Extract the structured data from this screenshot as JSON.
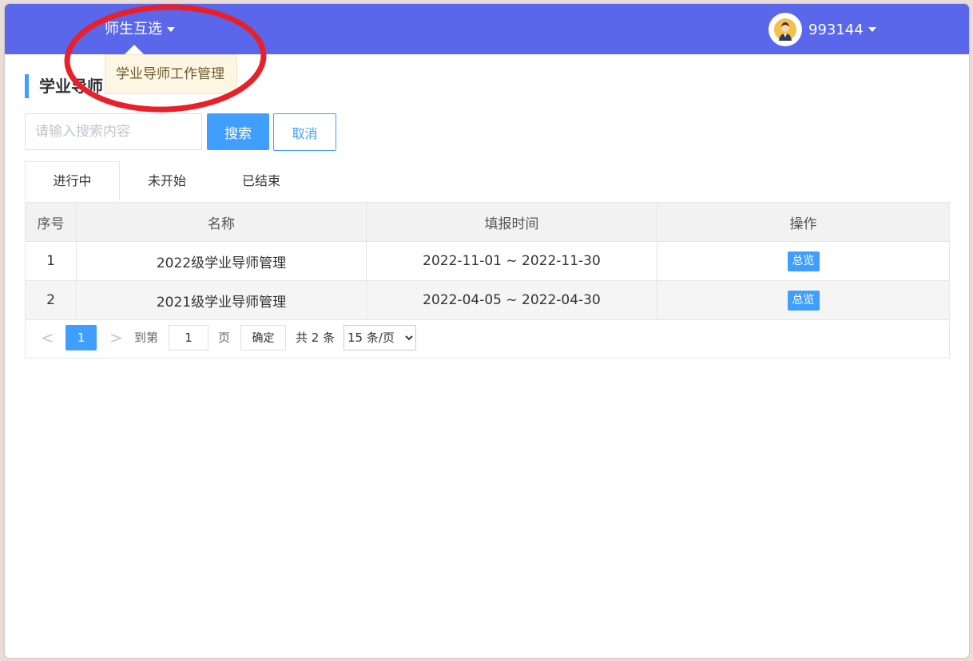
{
  "header": {
    "nav_menu_label": "师生互选",
    "dropdown_items": [
      "学业导师工作管理"
    ],
    "username": "993144"
  },
  "main": {
    "page_title": "学业导师",
    "search": {
      "placeholder": "请输入搜索内容",
      "value": ""
    },
    "search_button": "搜索",
    "cancel_button": "取消",
    "tabs": [
      {
        "label": "进行中",
        "active": true
      },
      {
        "label": "未开始",
        "active": false
      },
      {
        "label": "已结束",
        "active": false
      }
    ],
    "table": {
      "columns": [
        "序号",
        "名称",
        "填报时间",
        "操作"
      ],
      "rows": [
        {
          "index": "1",
          "name": "2022级学业导师管理",
          "period": "2022-11-01 ~ 2022-11-30",
          "action": "总览"
        },
        {
          "index": "2",
          "name": "2021级学业导师管理",
          "period": "2022-04-05 ~ 2022-04-30",
          "action": "总览"
        }
      ]
    },
    "pagination": {
      "prev": "<",
      "next": ">",
      "current_page": "1",
      "goto_prefix": "到第",
      "goto_value": "1",
      "goto_suffix": "页",
      "confirm": "确定",
      "total": "共 2 条",
      "page_size": "15 条/页"
    }
  },
  "colors": {
    "header_bg": "#5b67ea",
    "primary": "#409eff",
    "annotation": "#e8202a"
  },
  "icons": {
    "avatar": "user-avatar-icon",
    "caret": "caret-down-icon",
    "prev": "chevron-left-icon",
    "next": "chevron-right-icon"
  }
}
